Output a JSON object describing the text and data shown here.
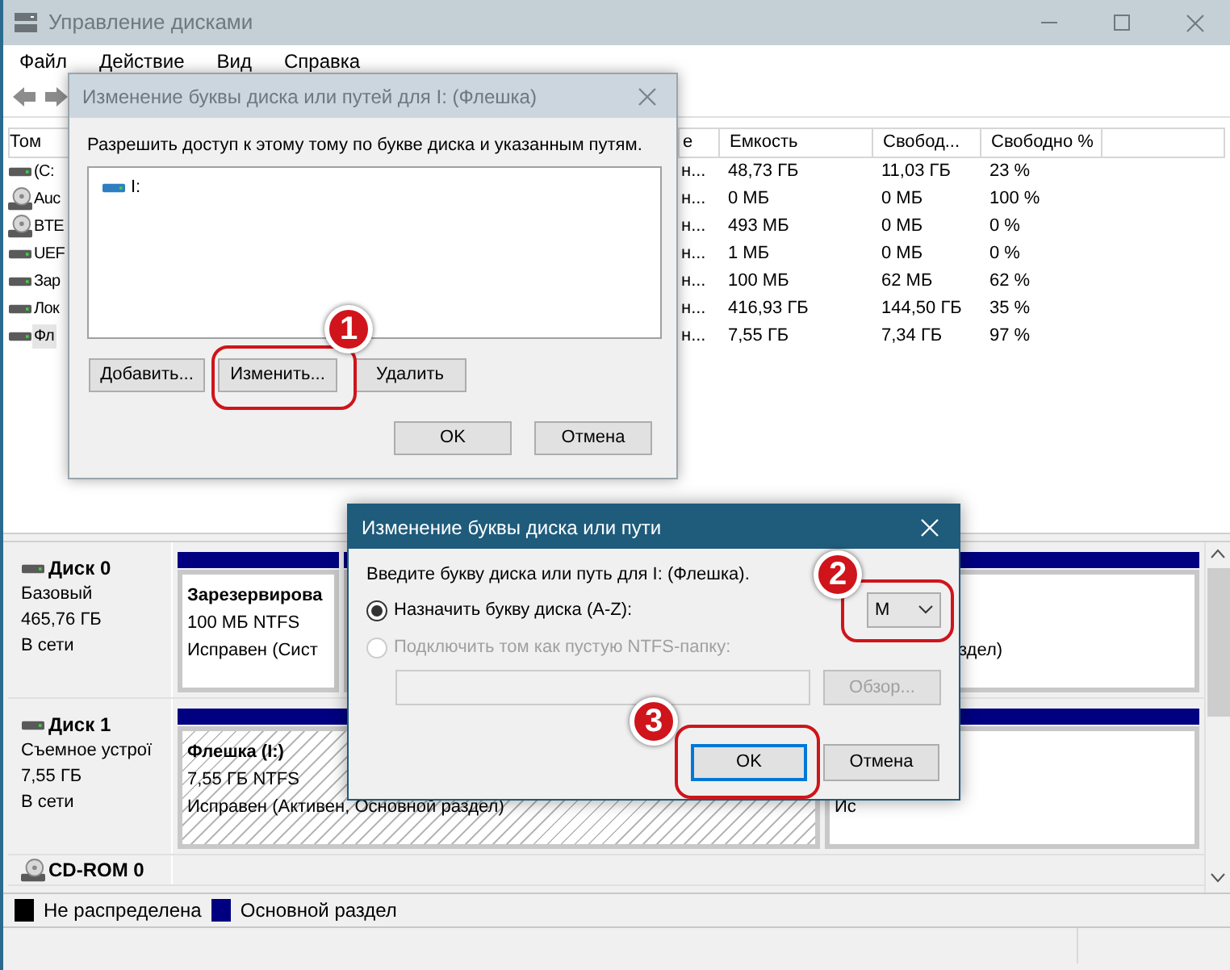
{
  "window": {
    "title": "Управление дисками",
    "active": false
  },
  "menu": [
    "Файл",
    "Действие",
    "Вид",
    "Справка"
  ],
  "table": {
    "columns": [
      "Том",
      "е",
      "Емкость",
      "Свобод...",
      "Свободно %"
    ],
    "rows": [
      {
        "kind": "drive",
        "selected": false,
        "cells": [
          "(C:",
          "н...",
          "48,73 ГБ",
          "11,03 ГБ",
          "23 %"
        ]
      },
      {
        "kind": "disc",
        "selected": false,
        "cells": [
          "Auc",
          "н...",
          "0 МБ",
          "0 МБ",
          "100 %"
        ]
      },
      {
        "kind": "disc",
        "selected": false,
        "cells": [
          "BTE",
          "н...",
          "493 МБ",
          "0 МБ",
          "0 %"
        ]
      },
      {
        "kind": "drive",
        "selected": false,
        "cells": [
          "UEF",
          "н...",
          "1 МБ",
          "0 МБ",
          "0 %"
        ]
      },
      {
        "kind": "drive",
        "selected": false,
        "cells": [
          "Зар",
          "н...",
          "100 МБ",
          "62 МБ",
          "62 %"
        ]
      },
      {
        "kind": "drive",
        "selected": false,
        "cells": [
          "Лок",
          "н...",
          "416,93 ГБ",
          "144,50 ГБ",
          "35 %"
        ]
      },
      {
        "kind": "drive",
        "selected": true,
        "cells": [
          "Фл",
          "н...",
          "7,55 ГБ",
          "7,34 ГБ",
          "97 %"
        ]
      }
    ]
  },
  "disks": [
    {
      "name": "Диск 0",
      "kind": "drive",
      "lines": [
        "Базовый",
        "465,76 ГБ",
        "В сети"
      ],
      "partitions": [
        {
          "title": "Зарезервирова",
          "lines": [
            "100 МБ NTFS",
            "Исправен (Сист"
          ],
          "selected": false
        },
        {
          "lines": [
            "здел)"
          ],
          "selected": false
        }
      ]
    },
    {
      "name": "Диск 1",
      "kind": "drive",
      "lines": [
        "Съемное устрої",
        "7,55 ГБ",
        "В сети"
      ],
      "partitions": [
        {
          "title": "Флешка (I:)",
          "lines": [
            "7,55 ГБ NTFS",
            "Исправен (Активен, Основной раздел)"
          ],
          "selected": true
        },
        {
          "lines": [
            "Ис"
          ],
          "selected": false
        }
      ]
    },
    {
      "name": "CD-ROM 0",
      "kind": "disc"
    }
  ],
  "legend": [
    {
      "label": "Не распределена",
      "color": "#000000"
    },
    {
      "label": "Основной раздел",
      "color": "#000080"
    }
  ],
  "dialog_paths": {
    "title": "Изменение буквы диска или путей для I: (Флешка)",
    "active": false,
    "prompt": "Разрешить доступ к этому тому по букве диска и указанным путям.",
    "paths": [
      "I:"
    ],
    "buttons": [
      {
        "label": "Добавить..."
      },
      {
        "label": "Изменить...",
        "annotation": "1"
      },
      {
        "label": "Удалить"
      }
    ],
    "footer_buttons": [
      "OK",
      "Отмена"
    ]
  },
  "dialog_letter": {
    "title": "Изменение буквы диска или пути",
    "active": true,
    "prompt": "Введите букву диска или путь для I: (Флешка).",
    "options": [
      {
        "label": "Назначить букву диска (A-Z):",
        "selected": true,
        "disabled": false
      },
      {
        "label": "Подключить том как пустую NTFS-папку:",
        "selected": false,
        "disabled": true
      }
    ],
    "letter": {
      "value": "M",
      "annotation": "2"
    },
    "path_field": {
      "disabled": true
    },
    "browse": {
      "label": "Обзор...",
      "disabled": true
    },
    "buttons": [
      {
        "label": "OK",
        "focused": true,
        "annotation": "3"
      },
      {
        "label": "Отмена",
        "focused": false
      }
    ]
  }
}
